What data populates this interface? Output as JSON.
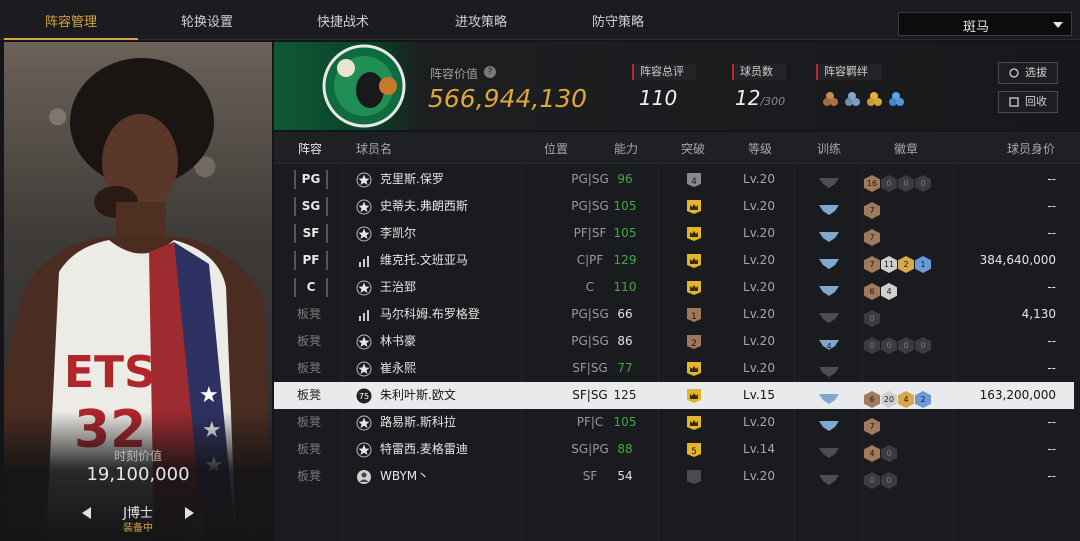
{
  "tabs": [
    "阵容管理",
    "轮换设置",
    "快捷战术",
    "进攻策略",
    "防守策略"
  ],
  "active_tab": 0,
  "team_select": "斑马",
  "card": {
    "moment_value_label": "时刻价值",
    "moment_value": "19,100,000",
    "player_name": "J博士",
    "status": "装备中"
  },
  "summary": {
    "lineup_value_label": "阵容价值",
    "lineup_value": "566,944,130",
    "rating_label": "阵容总评",
    "rating": "110",
    "player_count_label": "球员数",
    "player_count": "12",
    "player_count_max": "/300",
    "bond_label": "阵容羁绊",
    "select_button": "选拔",
    "recycle_button": "回收"
  },
  "columns": [
    "阵容",
    "球员名",
    "位置",
    "能力",
    "突破",
    "等级",
    "训练",
    "徽章",
    "球员身价"
  ],
  "rows": [
    {
      "slot": "PG",
      "starter": true,
      "name": "克里斯.保罗",
      "pos": "PG|SG",
      "ability": "96",
      "ability_color": "#3faa3f",
      "level": "Lv.20",
      "breakthrough": "4",
      "bt_type": "grey",
      "training": "grey",
      "badges": [
        "16",
        "0",
        "0",
        "0"
      ],
      "value": "--",
      "icon": "star"
    },
    {
      "slot": "SG",
      "starter": true,
      "name": "史蒂夫.弗朗西斯",
      "pos": "PG|SG",
      "ability": "105",
      "ability_color": "#3faa3f",
      "level": "Lv.20",
      "breakthrough": "",
      "bt_type": "crown",
      "training": "blue",
      "badges": [
        "7"
      ],
      "value": "--",
      "icon": "star"
    },
    {
      "slot": "SF",
      "starter": true,
      "name": "李凯尔",
      "pos": "PF|SF",
      "ability": "105",
      "ability_color": "#3faa3f",
      "level": "Lv.20",
      "breakthrough": "",
      "bt_type": "crown",
      "training": "blue",
      "badges": [
        "7"
      ],
      "value": "--",
      "icon": "star"
    },
    {
      "slot": "PF",
      "starter": true,
      "name": "维克托.文班亚马",
      "pos": "C|PF",
      "ability": "129",
      "ability_color": "#3faa3f",
      "level": "Lv.20",
      "breakthrough": "",
      "bt_type": "crown",
      "training": "blue",
      "badges": [
        "7",
        "11",
        "2",
        "1"
      ],
      "value": "384,640,000",
      "icon": "bars"
    },
    {
      "slot": "C",
      "starter": true,
      "name": "王治郅",
      "pos": "C",
      "ability": "110",
      "ability_color": "#3faa3f",
      "level": "Lv.20",
      "breakthrough": "",
      "bt_type": "crown",
      "training": "blue",
      "badges": [
        "6",
        "4"
      ],
      "value": "--",
      "icon": "star"
    },
    {
      "slot": "板凳",
      "starter": false,
      "name": "马尔科姆.布罗格登",
      "pos": "PG|SG",
      "ability": "66",
      "ability_color": "#e0e0e0",
      "level": "Lv.20",
      "breakthrough": "1",
      "bt_type": "brown",
      "training": "grey",
      "badges": [
        "0"
      ],
      "value": "4,130",
      "icon": "bars"
    },
    {
      "slot": "板凳",
      "starter": false,
      "name": "林书豪",
      "pos": "PG|SG",
      "ability": "86",
      "ability_color": "#e0e0e0",
      "level": "Lv.20",
      "breakthrough": "2",
      "bt_type": "brown",
      "training": "blue4",
      "badges": [
        "0",
        "0",
        "0",
        "0"
      ],
      "value": "--",
      "icon": "star"
    },
    {
      "slot": "板凳",
      "starter": false,
      "name": "崔永熙",
      "pos": "SF|SG",
      "ability": "77",
      "ability_color": "#3faa3f",
      "level": "Lv.20",
      "breakthrough": "",
      "bt_type": "crown",
      "training": "grey",
      "badges": [],
      "value": "--",
      "icon": "star"
    },
    {
      "slot": "板凳",
      "starter": false,
      "name": "朱利叶斯.欧文",
      "pos": "SF|SG",
      "ability": "125",
      "ability_color": "#222",
      "level": "Lv.15",
      "breakthrough": "",
      "bt_type": "crown",
      "training": "blue",
      "badges": [
        "6",
        "20",
        "4",
        "2"
      ],
      "value": "163,200,000",
      "icon": "num75",
      "selected": true
    },
    {
      "slot": "板凳",
      "starter": false,
      "name": "路易斯.斯科拉",
      "pos": "PF|C",
      "ability": "105",
      "ability_color": "#3faa3f",
      "level": "Lv.20",
      "breakthrough": "",
      "bt_type": "crown",
      "training": "blue",
      "badges": [
        "7"
      ],
      "value": "--",
      "icon": "star"
    },
    {
      "slot": "板凳",
      "starter": false,
      "name": "特雷西.麦格雷迪",
      "pos": "SG|PG",
      "ability": "88",
      "ability_color": "#3faa3f",
      "level": "Lv.14",
      "breakthrough": "5",
      "bt_type": "gold",
      "training": "grey",
      "badges": [
        "4",
        "0"
      ],
      "value": "--",
      "icon": "star"
    },
    {
      "slot": "板凳",
      "starter": false,
      "name": "WBYM丶",
      "pos": "SF",
      "ability": "54",
      "ability_color": "#e0e0e0",
      "level": "Lv.20",
      "breakthrough": "",
      "bt_type": "greyflat",
      "training": "grey",
      "badges": [
        "0",
        "0"
      ],
      "value": "--",
      "icon": "person"
    }
  ],
  "colors": {
    "accent": "#d9a441",
    "value_gold": "#e0a53a",
    "ability_green": "#3faa3f",
    "starter_red": "#c0282d"
  }
}
